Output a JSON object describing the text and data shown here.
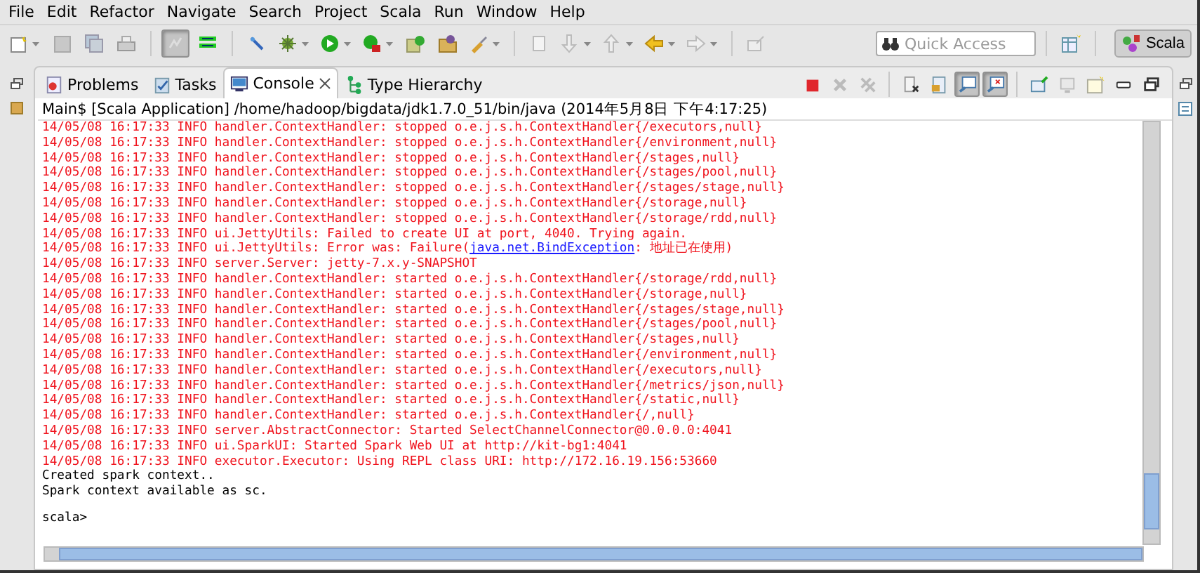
{
  "menu": [
    "File",
    "Edit",
    "Refactor",
    "Navigate",
    "Search",
    "Project",
    "Scala",
    "Run",
    "Window",
    "Help"
  ],
  "toolbar": [
    {
      "kind": "new",
      "dropdown": true,
      "pressed": false
    },
    {
      "kind": "save",
      "dropdown": false,
      "pressed": false
    },
    {
      "kind": "saveall",
      "dropdown": false,
      "pressed": false
    },
    {
      "kind": "print",
      "dropdown": false,
      "pressed": false
    },
    {
      "kind": "sep"
    },
    {
      "kind": "toggle",
      "dropdown": false,
      "pressed": true
    },
    {
      "kind": "tasklist",
      "dropdown": false,
      "pressed": false
    },
    {
      "kind": "sep"
    },
    {
      "kind": "pin",
      "dropdown": false,
      "pressed": false
    },
    {
      "kind": "bug",
      "dropdown": true,
      "pressed": false
    },
    {
      "kind": "run",
      "dropdown": true,
      "pressed": false
    },
    {
      "kind": "extrun",
      "dropdown": true,
      "pressed": false
    },
    {
      "kind": "newpkg",
      "dropdown": false,
      "pressed": false
    },
    {
      "kind": "folder",
      "dropdown": false,
      "pressed": false
    },
    {
      "kind": "brush",
      "dropdown": true,
      "pressed": false
    },
    {
      "kind": "sep"
    },
    {
      "kind": "page",
      "dropdown": false,
      "pressed": false
    },
    {
      "kind": "down",
      "dropdown": true,
      "pressed": false
    },
    {
      "kind": "up",
      "dropdown": true,
      "pressed": false
    },
    {
      "kind": "back",
      "dropdown": true,
      "pressed": false
    },
    {
      "kind": "forward",
      "dropdown": true,
      "pressed": false
    },
    {
      "kind": "sep"
    },
    {
      "kind": "external",
      "dropdown": false,
      "pressed": false
    }
  ],
  "quick_access": {
    "placeholder": "Quick Access"
  },
  "perspective": {
    "label": "Scala",
    "selected": true
  },
  "tabs": [
    {
      "label": "Problems",
      "kind": "problems",
      "selected": false,
      "closable": false
    },
    {
      "label": "Tasks",
      "kind": "tasks",
      "selected": false,
      "closable": false
    },
    {
      "label": "Console",
      "kind": "console",
      "selected": true,
      "closable": true
    },
    {
      "label": "Type Hierarchy",
      "kind": "hierarchy",
      "selected": false,
      "closable": false
    }
  ],
  "console_toolbar": [
    {
      "kind": "terminate",
      "pressed": false
    },
    {
      "kind": "remove",
      "pressed": false
    },
    {
      "kind": "removeall",
      "pressed": false
    },
    {
      "kind": "sep"
    },
    {
      "kind": "clear",
      "pressed": false
    },
    {
      "kind": "lock",
      "pressed": false
    },
    {
      "kind": "showout",
      "pressed": true
    },
    {
      "kind": "showerr",
      "pressed": true
    },
    {
      "kind": "sep"
    },
    {
      "kind": "pinconsole",
      "pressed": false
    },
    {
      "kind": "display",
      "pressed": false
    },
    {
      "kind": "newconsole",
      "pressed": false
    },
    {
      "kind": "minimize",
      "pressed": false
    },
    {
      "kind": "maximize",
      "pressed": false
    }
  ],
  "console": {
    "header": "Main$ [Scala Application] /home/hadoop/bigdata/jdk1.7.0_51/bin/java (2014年5月8日 下午4:17:25)",
    "lines": [
      {
        "kind": "err",
        "text": "14/05/08 16:17:33 INFO handler.ContextHandler: stopped o.e.j.s.h.ContextHandler{/executors,null}"
      },
      {
        "kind": "err",
        "text": "14/05/08 16:17:33 INFO handler.ContextHandler: stopped o.e.j.s.h.ContextHandler{/environment,null}"
      },
      {
        "kind": "err",
        "text": "14/05/08 16:17:33 INFO handler.ContextHandler: stopped o.e.j.s.h.ContextHandler{/stages,null}"
      },
      {
        "kind": "err",
        "text": "14/05/08 16:17:33 INFO handler.ContextHandler: stopped o.e.j.s.h.ContextHandler{/stages/pool,null}"
      },
      {
        "kind": "err",
        "text": "14/05/08 16:17:33 INFO handler.ContextHandler: stopped o.e.j.s.h.ContextHandler{/stages/stage,null}"
      },
      {
        "kind": "err",
        "text": "14/05/08 16:17:33 INFO handler.ContextHandler: stopped o.e.j.s.h.ContextHandler{/storage,null}"
      },
      {
        "kind": "err",
        "text": "14/05/08 16:17:33 INFO handler.ContextHandler: stopped o.e.j.s.h.ContextHandler{/storage/rdd,null}"
      },
      {
        "kind": "err",
        "text": "14/05/08 16:17:33 INFO ui.JettyUtils: Failed to create UI at port, 4040. Trying again."
      },
      {
        "kind": "err",
        "text": "14/05/08 16:17:33 INFO ui.JettyUtils: Error was: Failure(",
        "link": "java.net.BindException",
        "after": ": 地址已在使用)"
      },
      {
        "kind": "err",
        "text": "14/05/08 16:17:33 INFO server.Server: jetty-7.x.y-SNAPSHOT"
      },
      {
        "kind": "err",
        "text": "14/05/08 16:17:33 INFO handler.ContextHandler: started o.e.j.s.h.ContextHandler{/storage/rdd,null}"
      },
      {
        "kind": "err",
        "text": "14/05/08 16:17:33 INFO handler.ContextHandler: started o.e.j.s.h.ContextHandler{/storage,null}"
      },
      {
        "kind": "err",
        "text": "14/05/08 16:17:33 INFO handler.ContextHandler: started o.e.j.s.h.ContextHandler{/stages/stage,null}"
      },
      {
        "kind": "err",
        "text": "14/05/08 16:17:33 INFO handler.ContextHandler: started o.e.j.s.h.ContextHandler{/stages/pool,null}"
      },
      {
        "kind": "err",
        "text": "14/05/08 16:17:33 INFO handler.ContextHandler: started o.e.j.s.h.ContextHandler{/stages,null}"
      },
      {
        "kind": "err",
        "text": "14/05/08 16:17:33 INFO handler.ContextHandler: started o.e.j.s.h.ContextHandler{/environment,null}"
      },
      {
        "kind": "err",
        "text": "14/05/08 16:17:33 INFO handler.ContextHandler: started o.e.j.s.h.ContextHandler{/executors,null}"
      },
      {
        "kind": "err",
        "text": "14/05/08 16:17:33 INFO handler.ContextHandler: started o.e.j.s.h.ContextHandler{/metrics/json,null}"
      },
      {
        "kind": "err",
        "text": "14/05/08 16:17:33 INFO handler.ContextHandler: started o.e.j.s.h.ContextHandler{/static,null}"
      },
      {
        "kind": "err",
        "text": "14/05/08 16:17:33 INFO handler.ContextHandler: started o.e.j.s.h.ContextHandler{/,null}"
      },
      {
        "kind": "err",
        "text": "14/05/08 16:17:33 INFO server.AbstractConnector: Started SelectChannelConnector@0.0.0.0:4041"
      },
      {
        "kind": "err",
        "text": "14/05/08 16:17:33 INFO ui.SparkUI: Started Spark Web UI at http://kit-bg1:4041"
      },
      {
        "kind": "err",
        "text": "14/05/08 16:17:33 INFO executor.Executor: Using REPL class URI: http://172.16.19.156:53660"
      },
      {
        "kind": "out",
        "text": "Created spark context.."
      },
      {
        "kind": "out",
        "text": "Spark context available as sc."
      }
    ],
    "prompt": "scala>"
  }
}
